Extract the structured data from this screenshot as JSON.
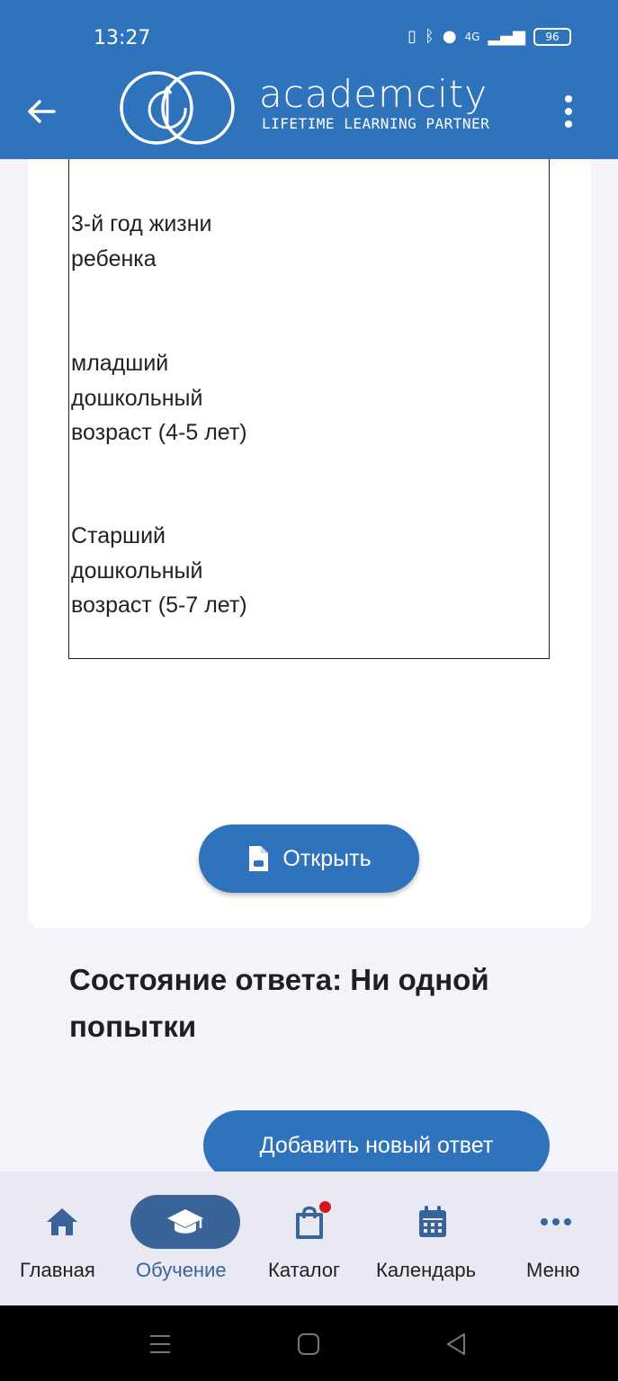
{
  "status_bar": {
    "time": "13:27",
    "network": "4G",
    "battery": "96"
  },
  "header": {
    "brand": "academcity",
    "tagline": "LIFETIME LEARNING PARTNER",
    "accent_color": "#2f73bd"
  },
  "content": {
    "age_groups": [
      "3-й год жизни ребенка",
      "младший дошкольный возраст (4-5 лет)",
      "Старший дошкольный возраст (5-7 лет)"
    ],
    "open_button": "Открыть",
    "answer_state": "Состояние ответа: Ни одной попытки",
    "add_answer_button": "Добавить новый ответ"
  },
  "bottom_nav": {
    "items": [
      {
        "label": "Главная",
        "icon": "home-icon"
      },
      {
        "label": "Обучение",
        "icon": "graduation-cap-icon",
        "active": true
      },
      {
        "label": "Каталог",
        "icon": "shopping-bag-icon",
        "badge": true
      },
      {
        "label": "Календарь",
        "icon": "calendar-icon"
      },
      {
        "label": "Меню",
        "icon": "more-dots-icon"
      }
    ]
  }
}
